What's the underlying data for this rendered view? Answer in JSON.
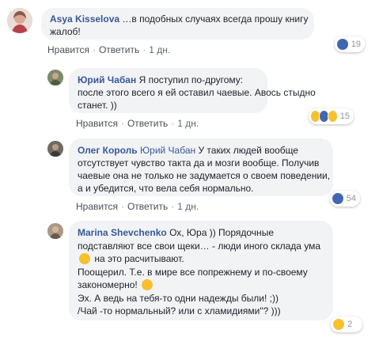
{
  "comments": [
    {
      "author": "Asya Kisselova",
      "lines": [
        "…в подобных случаях всегда прошу книгу",
        "жалоб!"
      ],
      "actions": {
        "like": "Нравится",
        "reply": "Ответить",
        "time": "1 дн."
      },
      "reaction_count": "19"
    },
    {
      "author": "Юрий Чабан",
      "lines": [
        "Я поступил по-другому:",
        "после этого всего я ей оставил чаевые. Авось стыдно",
        "станет. ))"
      ],
      "actions": {
        "like": "Нравится",
        "reply": "Ответить",
        "time": "1 дн."
      },
      "reaction_count": "15"
    },
    {
      "author": "Олег Король",
      "mention": "Юрий Чабан",
      "lines": [
        "У таких людей вообще",
        "отсутствует чувство такта да и мозги вообще. Получив",
        "чаевые она не только не задумается о своем поведении,",
        "а и убедится, что вела себя нормально."
      ],
      "actions": {
        "like": "Нравится",
        "reply": "Ответить",
        "time": "1 дн."
      },
      "reaction_count": "54"
    },
    {
      "author": "Marina Shevchenko",
      "lines": [
        "Ох, Юра )) Порядочные",
        "подставляют все свои щеки… - люди иного склада ума",
        "на это расчитывают.",
        "Поощерил. Т.е. в мире все попрежнему и по-своему",
        "закономерно!",
        "Эх. А ведь на тебя-то одни надежды были! ;))",
        "/Чай -то нормальный? или с хламидиями\"? )))"
      ],
      "actions": {
        "like": "Нравится",
        "reply": "Ответить",
        "time": "1 дн."
      },
      "reaction_count": "2"
    }
  ]
}
